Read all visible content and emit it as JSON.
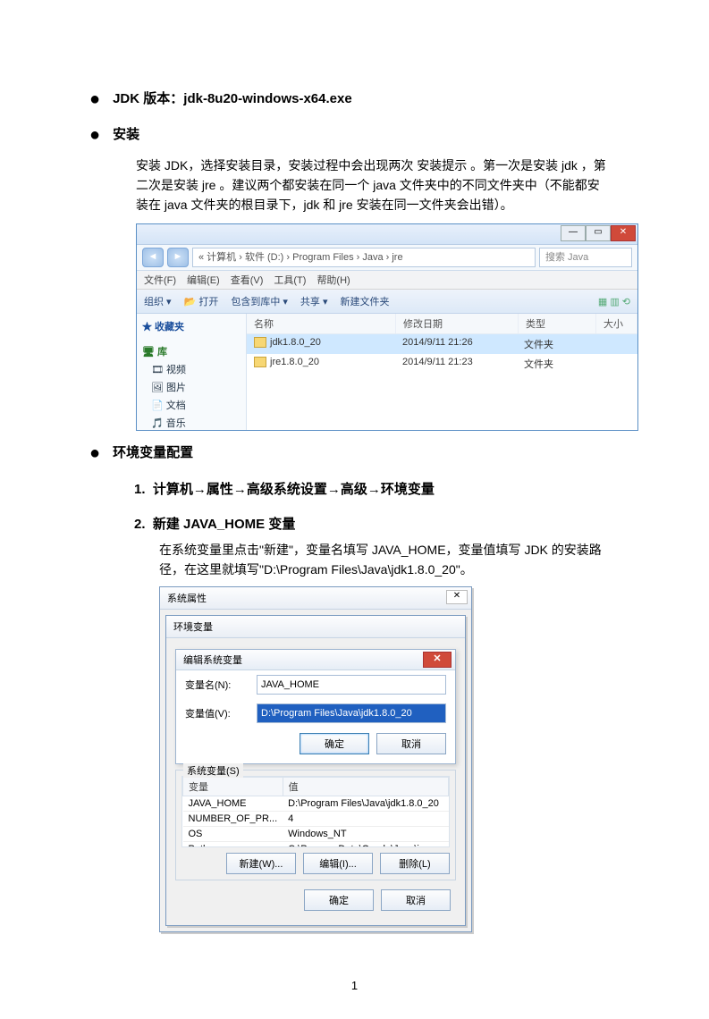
{
  "heading1_label": "JDK 版本：",
  "heading1_value": "jdk-8u20-windows-x64.exe",
  "heading2": "安装",
  "para_install": "安装 JDK，选择安装目录，安装过程中会出现两次 安装提示 。第一次是安装 jdk ，第二次是安装 jre 。建议两个都安装在同一个 java 文件夹中的不同文件夹中（不能都安装在 java 文件夹的根目录下，jdk 和 jre 安装在同一文件夹会出错）。",
  "explorer": {
    "breadcrumb": "« 计算机 › 软件 (D:) › Program Files › Java › jre",
    "search": "搜索 Java",
    "menu": [
      "文件(F)",
      "编辑(E)",
      "查看(V)",
      "工具(T)",
      "帮助(H)"
    ],
    "toolbar": [
      "组织 ▾",
      "📂 打开",
      "包含到库中 ▾",
      "共享 ▾",
      "新建文件夹"
    ],
    "columns": {
      "name": "名称",
      "date": "修改日期",
      "type": "类型",
      "size": "大小"
    },
    "sidebar": {
      "fav": "★ 收藏夹",
      "lib": "库",
      "video": "视频",
      "pic": "图片",
      "doc": "文档",
      "music": "音乐"
    },
    "files": [
      {
        "name": "jdk1.8.0_20",
        "date": "2014/9/11 21:26",
        "type": "文件夹",
        "sel": true
      },
      {
        "name": "jre1.8.0_20",
        "date": "2014/9/11 21:23",
        "type": "文件夹",
        "sel": false
      }
    ]
  },
  "heading3": "环境变量配置",
  "step1": "计算机→属性→高级系统设置→高级→环境变量",
  "step2": "新建 JAVA_HOME 变量",
  "step2_para": "在系统变量里点击\"新建\"，变量名填写 JAVA_HOME，变量值填写 JDK 的安装路 径，在这里就填写\"D:\\Program Files\\Java\\jdk1.8.0_20\"。",
  "dlg": {
    "sysprop_title": "系统属性",
    "envvar_title": "环境变量",
    "edit_title": "编辑系统变量",
    "name_label": "变量名(N):",
    "name_value": "JAVA_HOME",
    "value_label": "变量值(V):",
    "value_value": "D:\\Program Files\\Java\\jdk1.8.0_20",
    "ok": "确定",
    "cancel": "取消",
    "sysvar_title": "系统变量(S)",
    "col_var": "变量",
    "col_val": "值",
    "rows": [
      {
        "v": "JAVA_HOME",
        "val": "D:\\Program Files\\Java\\jdk1.8.0_20"
      },
      {
        "v": "NUMBER_OF_PR...",
        "val": "4"
      },
      {
        "v": "OS",
        "val": "Windows_NT"
      },
      {
        "v": "Path",
        "val": "C:\\ProgramData\\Oracle\\Java\\java..."
      }
    ],
    "new": "新建(W)...",
    "edit": "编辑(I)...",
    "delete": "删除(L)"
  },
  "page_num": "1"
}
